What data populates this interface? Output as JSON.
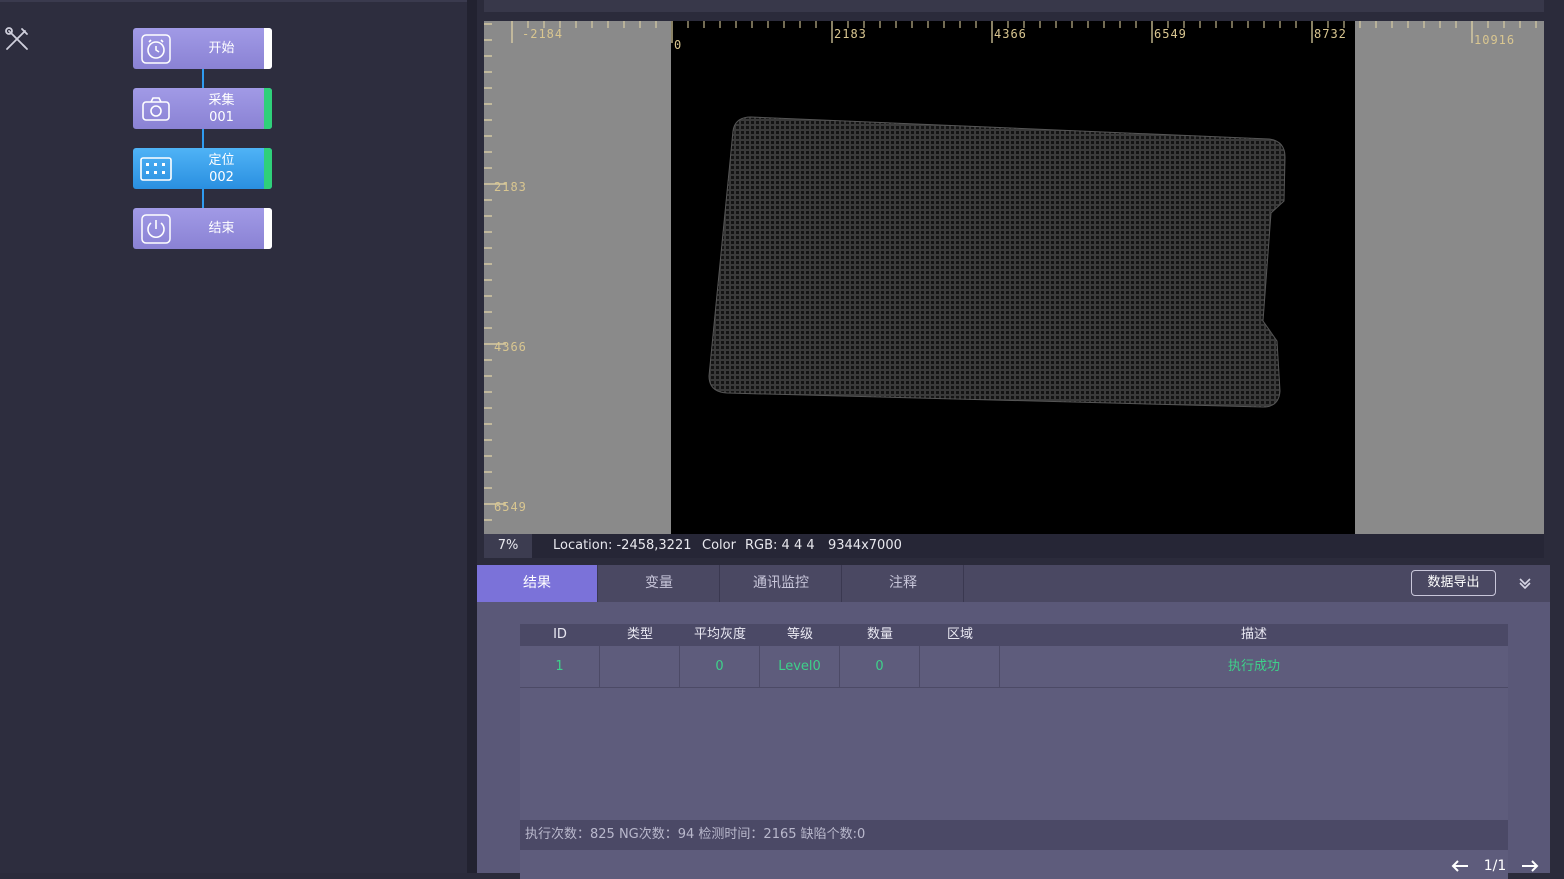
{
  "flow": {
    "nodes": [
      {
        "label": "开始",
        "icon": "alarm-clock-icon"
      },
      {
        "label": "采集\n001",
        "icon": "camera-icon"
      },
      {
        "label": "定位\n002",
        "icon": "locate-grid-icon"
      },
      {
        "label": "结束",
        "icon": "power-icon"
      }
    ]
  },
  "viewer": {
    "ruler_h_labels": [
      "-2184",
      "0",
      "2183",
      "4366",
      "6549",
      "8732",
      "10916"
    ],
    "ruler_v_labels": [
      "2183",
      "4366",
      "6549"
    ],
    "zoom": "7%",
    "location": "Location: -2458,3221",
    "color_label": "Color",
    "rgb": "RGB: 4 4 4",
    "size": "9344x7000"
  },
  "results": {
    "tabs": [
      "结果",
      "变量",
      "通讯监控",
      "注释"
    ],
    "active_tab": 0,
    "export_label": "数据导出",
    "columns": [
      "ID",
      "类型",
      "平均灰度",
      "等级",
      "数量",
      "区域",
      "描述"
    ],
    "rows": [
      {
        "id": "1",
        "type": "",
        "avg_gray": "0",
        "level": "Level0",
        "count": "0",
        "region": "",
        "desc": "执行成功"
      }
    ],
    "page": "1/1",
    "footer": "执行次数：825 NG次数：94 检测时间：2165 缺陷个数:0"
  },
  "colors": {
    "accent": "#7b72d9",
    "success": "#3ed18a",
    "node_purple": "#9a92e0",
    "node_blue": "#3aa2ee",
    "ruler_text": "#d9c690"
  }
}
